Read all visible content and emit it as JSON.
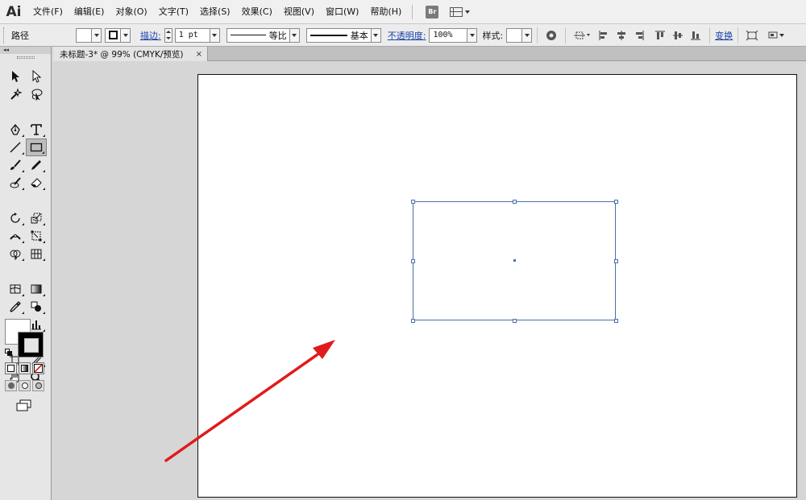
{
  "app": {
    "logo": "Ai"
  },
  "menubar": {
    "items": [
      "文件(F)",
      "编辑(E)",
      "对象(O)",
      "文字(T)",
      "选择(S)",
      "效果(C)",
      "视图(V)",
      "窗口(W)",
      "帮助(H)"
    ],
    "bridge_label": "Br"
  },
  "controlbar": {
    "selection_type": "路径",
    "stroke_link": "描边:",
    "stroke_weight": "1 pt",
    "variable_width_profile": "等比",
    "brush_definition": "基本",
    "opacity_link": "不透明度:",
    "opacity_value": "100%",
    "style_label": "样式:",
    "transform_link": "变换"
  },
  "document_tab": {
    "title": "未标题-3* @ 99% (CMYK/预览)",
    "close": "×"
  },
  "tools_panel": {
    "collapse_label": "◂◂"
  },
  "colors": {
    "accent": "#4a6fad",
    "arrow": "#e01b1b"
  }
}
